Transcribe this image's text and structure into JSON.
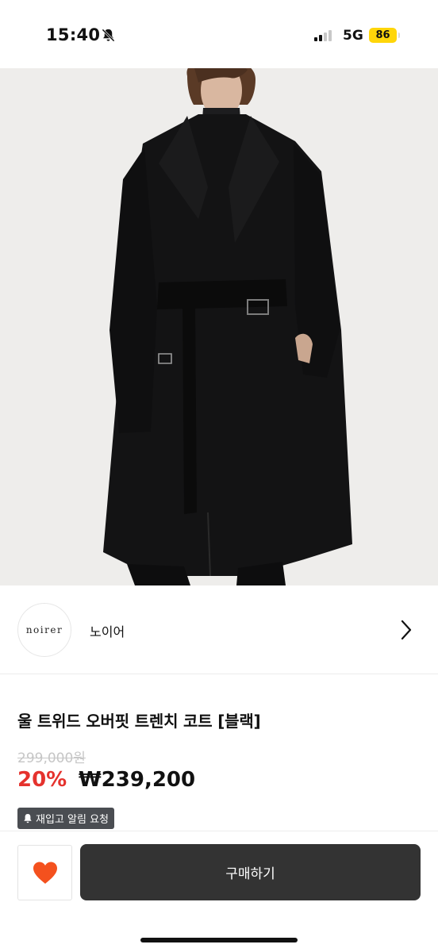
{
  "status_bar": {
    "time": "15:40",
    "network": "5G",
    "battery": "86",
    "icons": [
      "bell-slash-icon",
      "signal-icon"
    ]
  },
  "hero": {
    "image": "black-wool-trench-coat-model-photo"
  },
  "shop": {
    "logo_text": "noirer",
    "name": "노이어"
  },
  "product": {
    "title": "울 트위드 오버핏 트렌치 코트 [블랙]",
    "original_price": "299,000원",
    "discount": "20%",
    "price": "₩239,200",
    "restock_label": "재입고 알림 요청"
  },
  "actions": {
    "buy_label": "구매하기",
    "like_icon": "heart-icon",
    "like_color": "#f4511e"
  },
  "colors": {
    "discount": "#e5322d",
    "buy_button": "#333333",
    "battery": "#ffd60a"
  }
}
